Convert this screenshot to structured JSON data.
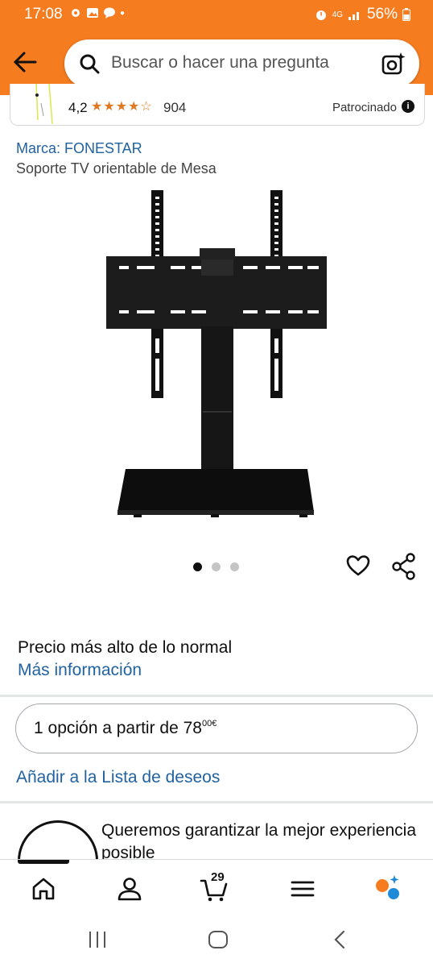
{
  "status_bar": {
    "time": "17:08",
    "network": "4G",
    "battery": "56%"
  },
  "header": {
    "back_icon": "arrow-left-icon",
    "search_placeholder": "Buscar o hacer una pregunta",
    "camera_icon": "camera-search-icon",
    "background_color": "#f57c1f"
  },
  "sponsored": {
    "rating": "4,2",
    "stars": "★★★★☆",
    "review_count": "904",
    "label": "Patrocinado"
  },
  "product": {
    "brand_link": "Marca: FONESTAR",
    "title": "Soporte TV orientable de Mesa",
    "image_count": 3,
    "active_image": 1
  },
  "pricing": {
    "notice": "Precio más alto de lo normal",
    "more_info": "Más información",
    "offer_prefix": "1 opción a partir de ",
    "offer_whole": "78",
    "offer_fraction": "00",
    "offer_currency": "€"
  },
  "wishlist": {
    "label": "Añadir a la Lista de deseos"
  },
  "promo": {
    "text": "Queremos garantizar la mejor experiencia posible"
  },
  "bottom_nav": {
    "items": [
      "home-icon",
      "account-icon",
      "cart-icon",
      "menu-icon",
      "assistant-icon"
    ],
    "cart_count": "29"
  },
  "colors": {
    "link": "#2162a1",
    "star": "#de7921",
    "accent": "#f57c1f"
  }
}
